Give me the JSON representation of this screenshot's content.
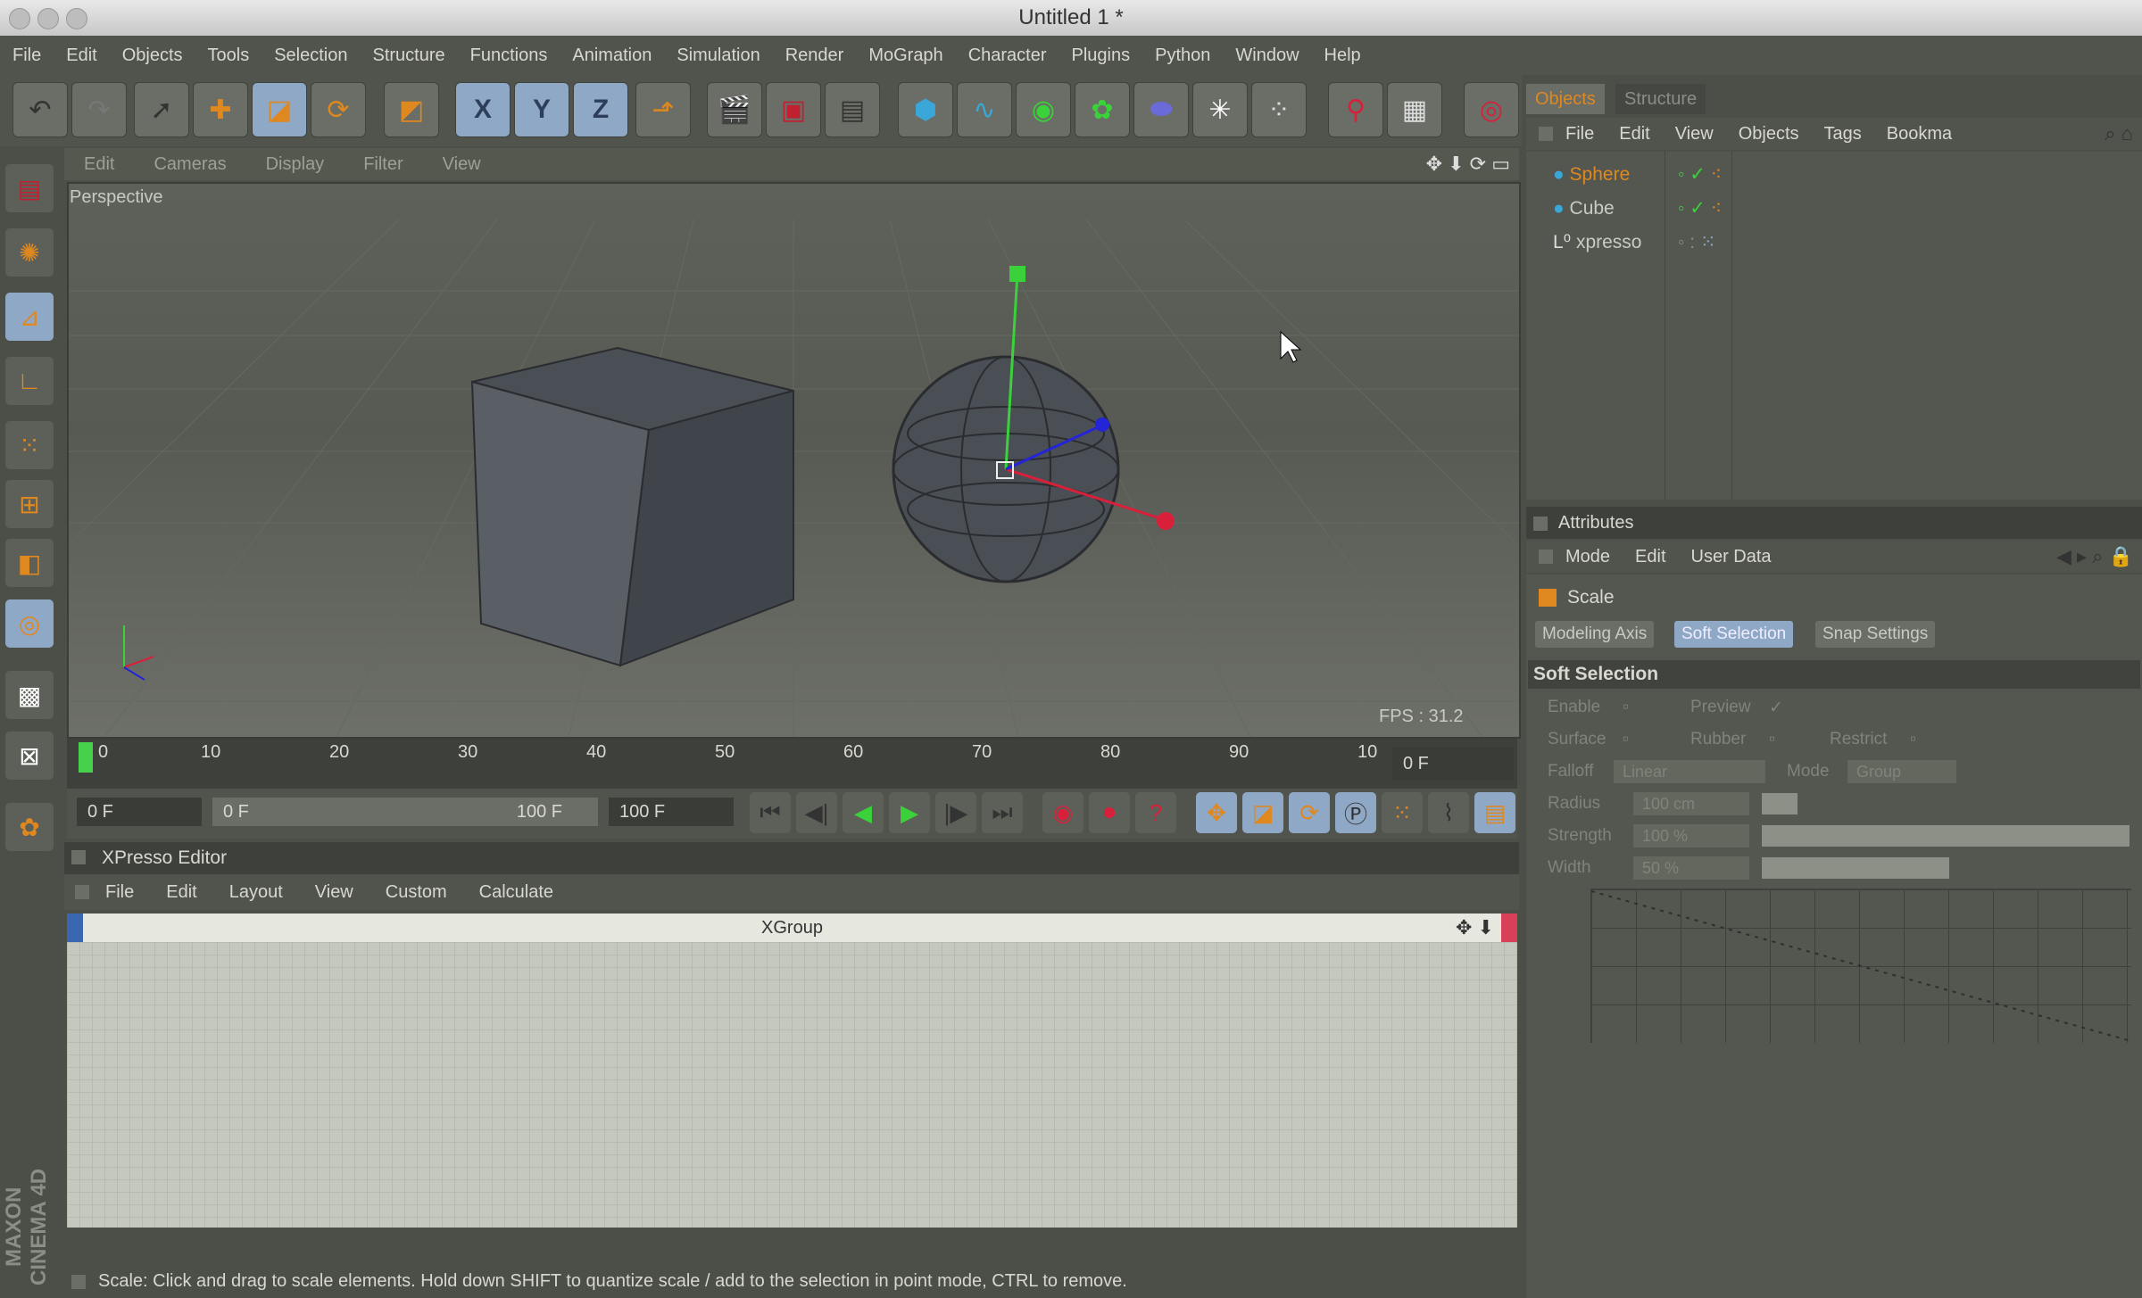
{
  "window": {
    "title": "Untitled 1 *"
  },
  "menubar": [
    "File",
    "Edit",
    "Objects",
    "Tools",
    "Selection",
    "Structure",
    "Functions",
    "Animation",
    "Simulation",
    "Render",
    "MoGraph",
    "Character",
    "Plugins",
    "Python",
    "Window",
    "Help"
  ],
  "toolbar": {
    "x_label": "X",
    "y_label": "Y",
    "z_label": "Z"
  },
  "viewport": {
    "menu": [
      "Edit",
      "Cameras",
      "Display",
      "Filter",
      "View"
    ],
    "camera_label": "Perspective",
    "fps": "FPS : 31.2"
  },
  "timeline": {
    "ticks": [
      "0",
      "10",
      "20",
      "30",
      "40",
      "50",
      "60",
      "70",
      "80",
      "90",
      "10"
    ],
    "current_frame": "0 F",
    "start_field": "0 F",
    "range_start": "0 F",
    "range_end": "100 F",
    "end_field": "100 F"
  },
  "xpresso": {
    "title": "XPresso Editor",
    "menu": [
      "File",
      "Edit",
      "Layout",
      "View",
      "Custom",
      "Calculate"
    ],
    "group_label": "XGroup"
  },
  "status": {
    "text": "Scale: Click and drag to scale elements. Hold down SHIFT to quantize scale / add to the selection in point mode, CTRL to remove."
  },
  "objects": {
    "tabs": [
      "Objects",
      "Structure"
    ],
    "menu": [
      "File",
      "Edit",
      "View",
      "Objects",
      "Tags",
      "Bookma"
    ],
    "items": [
      {
        "name": "Sphere",
        "selected": true
      },
      {
        "name": "Cube",
        "selected": false
      },
      {
        "name": "xpresso",
        "selected": false
      }
    ]
  },
  "attributes": {
    "title": "Attributes",
    "menu": [
      "Mode",
      "Edit",
      "User Data"
    ],
    "tool_name": "Scale",
    "subtabs": [
      "Modeling Axis",
      "Soft Selection",
      "Snap Settings"
    ],
    "section": "Soft Selection",
    "labels": {
      "enable": "Enable",
      "preview": "Preview",
      "surface": "Surface",
      "rubber": "Rubber",
      "restrict": "Restrict",
      "falloff": "Falloff",
      "falloff_value": "Linear",
      "mode": "Mode",
      "mode_value": "Group",
      "radius": "Radius",
      "radius_value": "100 cm",
      "strength": "Strength",
      "strength_value": "100 %",
      "width": "Width",
      "width_value": "50 %"
    }
  },
  "branding": {
    "vendor": "MAXON",
    "product": "CINEMA 4D"
  },
  "colors": {
    "accent_orange": "#e08820",
    "selection_blue": "#8fa8c6",
    "axis_x": "#d8203a",
    "axis_y": "#3bd13b",
    "axis_z": "#2424d8"
  }
}
